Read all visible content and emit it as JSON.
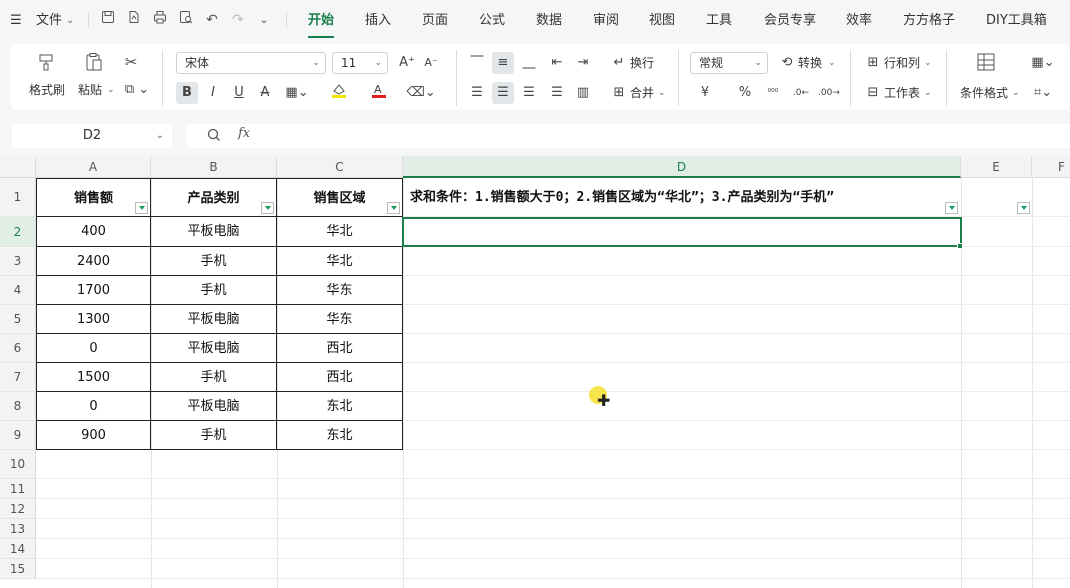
{
  "menubar": {
    "file_label": "文件",
    "tabs": [
      {
        "label": "开始",
        "active": true
      },
      {
        "label": "插入",
        "active": false
      },
      {
        "label": "页面",
        "active": false
      },
      {
        "label": "公式",
        "active": false
      },
      {
        "label": "数据",
        "active": false
      },
      {
        "label": "审阅",
        "active": false
      },
      {
        "label": "视图",
        "active": false
      },
      {
        "label": "工具",
        "active": false
      },
      {
        "label": "会员专享",
        "active": false
      },
      {
        "label": "效率",
        "active": false
      },
      {
        "label": "方方格子",
        "active": false
      },
      {
        "label": "DIY工具箱",
        "active": false
      }
    ]
  },
  "ribbon": {
    "format_painter": "格式刷",
    "paste": "粘贴",
    "font_name": "宋体",
    "font_size": "11",
    "wrap": "换行",
    "merge": "合并",
    "number_format": "常规",
    "convert": "转换",
    "row_col": "行和列",
    "worksheet": "工作表",
    "cond_format": "条件格式",
    "bold": "B",
    "italic": "I",
    "underline": "U",
    "strike": "A",
    "currency": "¥",
    "percent": "%",
    "font_color": "#e02020",
    "highlight_color": "#f2e600"
  },
  "formula_bar": {
    "name_box": "D2",
    "fx": "fx",
    "value": ""
  },
  "sheet": {
    "columns": [
      "A",
      "B",
      "C",
      "D",
      "E",
      "F"
    ],
    "rows": [
      "1",
      "2",
      "3",
      "4",
      "5",
      "6",
      "7",
      "8",
      "9",
      "10",
      "11",
      "12",
      "13",
      "14",
      "15"
    ],
    "header": [
      "销售额",
      "产品类别",
      "销售区域"
    ],
    "data": [
      [
        "400",
        "平板电脑",
        "华北"
      ],
      [
        "2400",
        "手机",
        "华北"
      ],
      [
        "1700",
        "手机",
        "华东"
      ],
      [
        "1300",
        "平板电脑",
        "华东"
      ],
      [
        "0",
        "平板电脑",
        "西北"
      ],
      [
        "1500",
        "手机",
        "西北"
      ],
      [
        "0",
        "平板电脑",
        "东北"
      ],
      [
        "900",
        "手机",
        "东北"
      ]
    ],
    "d1_text": "求和条件：1.销售额大于0；2.销售区域为“华北”；3.产品类别为“手机”",
    "selected_cell": "D2",
    "accent_color": "#1a7f4b"
  }
}
